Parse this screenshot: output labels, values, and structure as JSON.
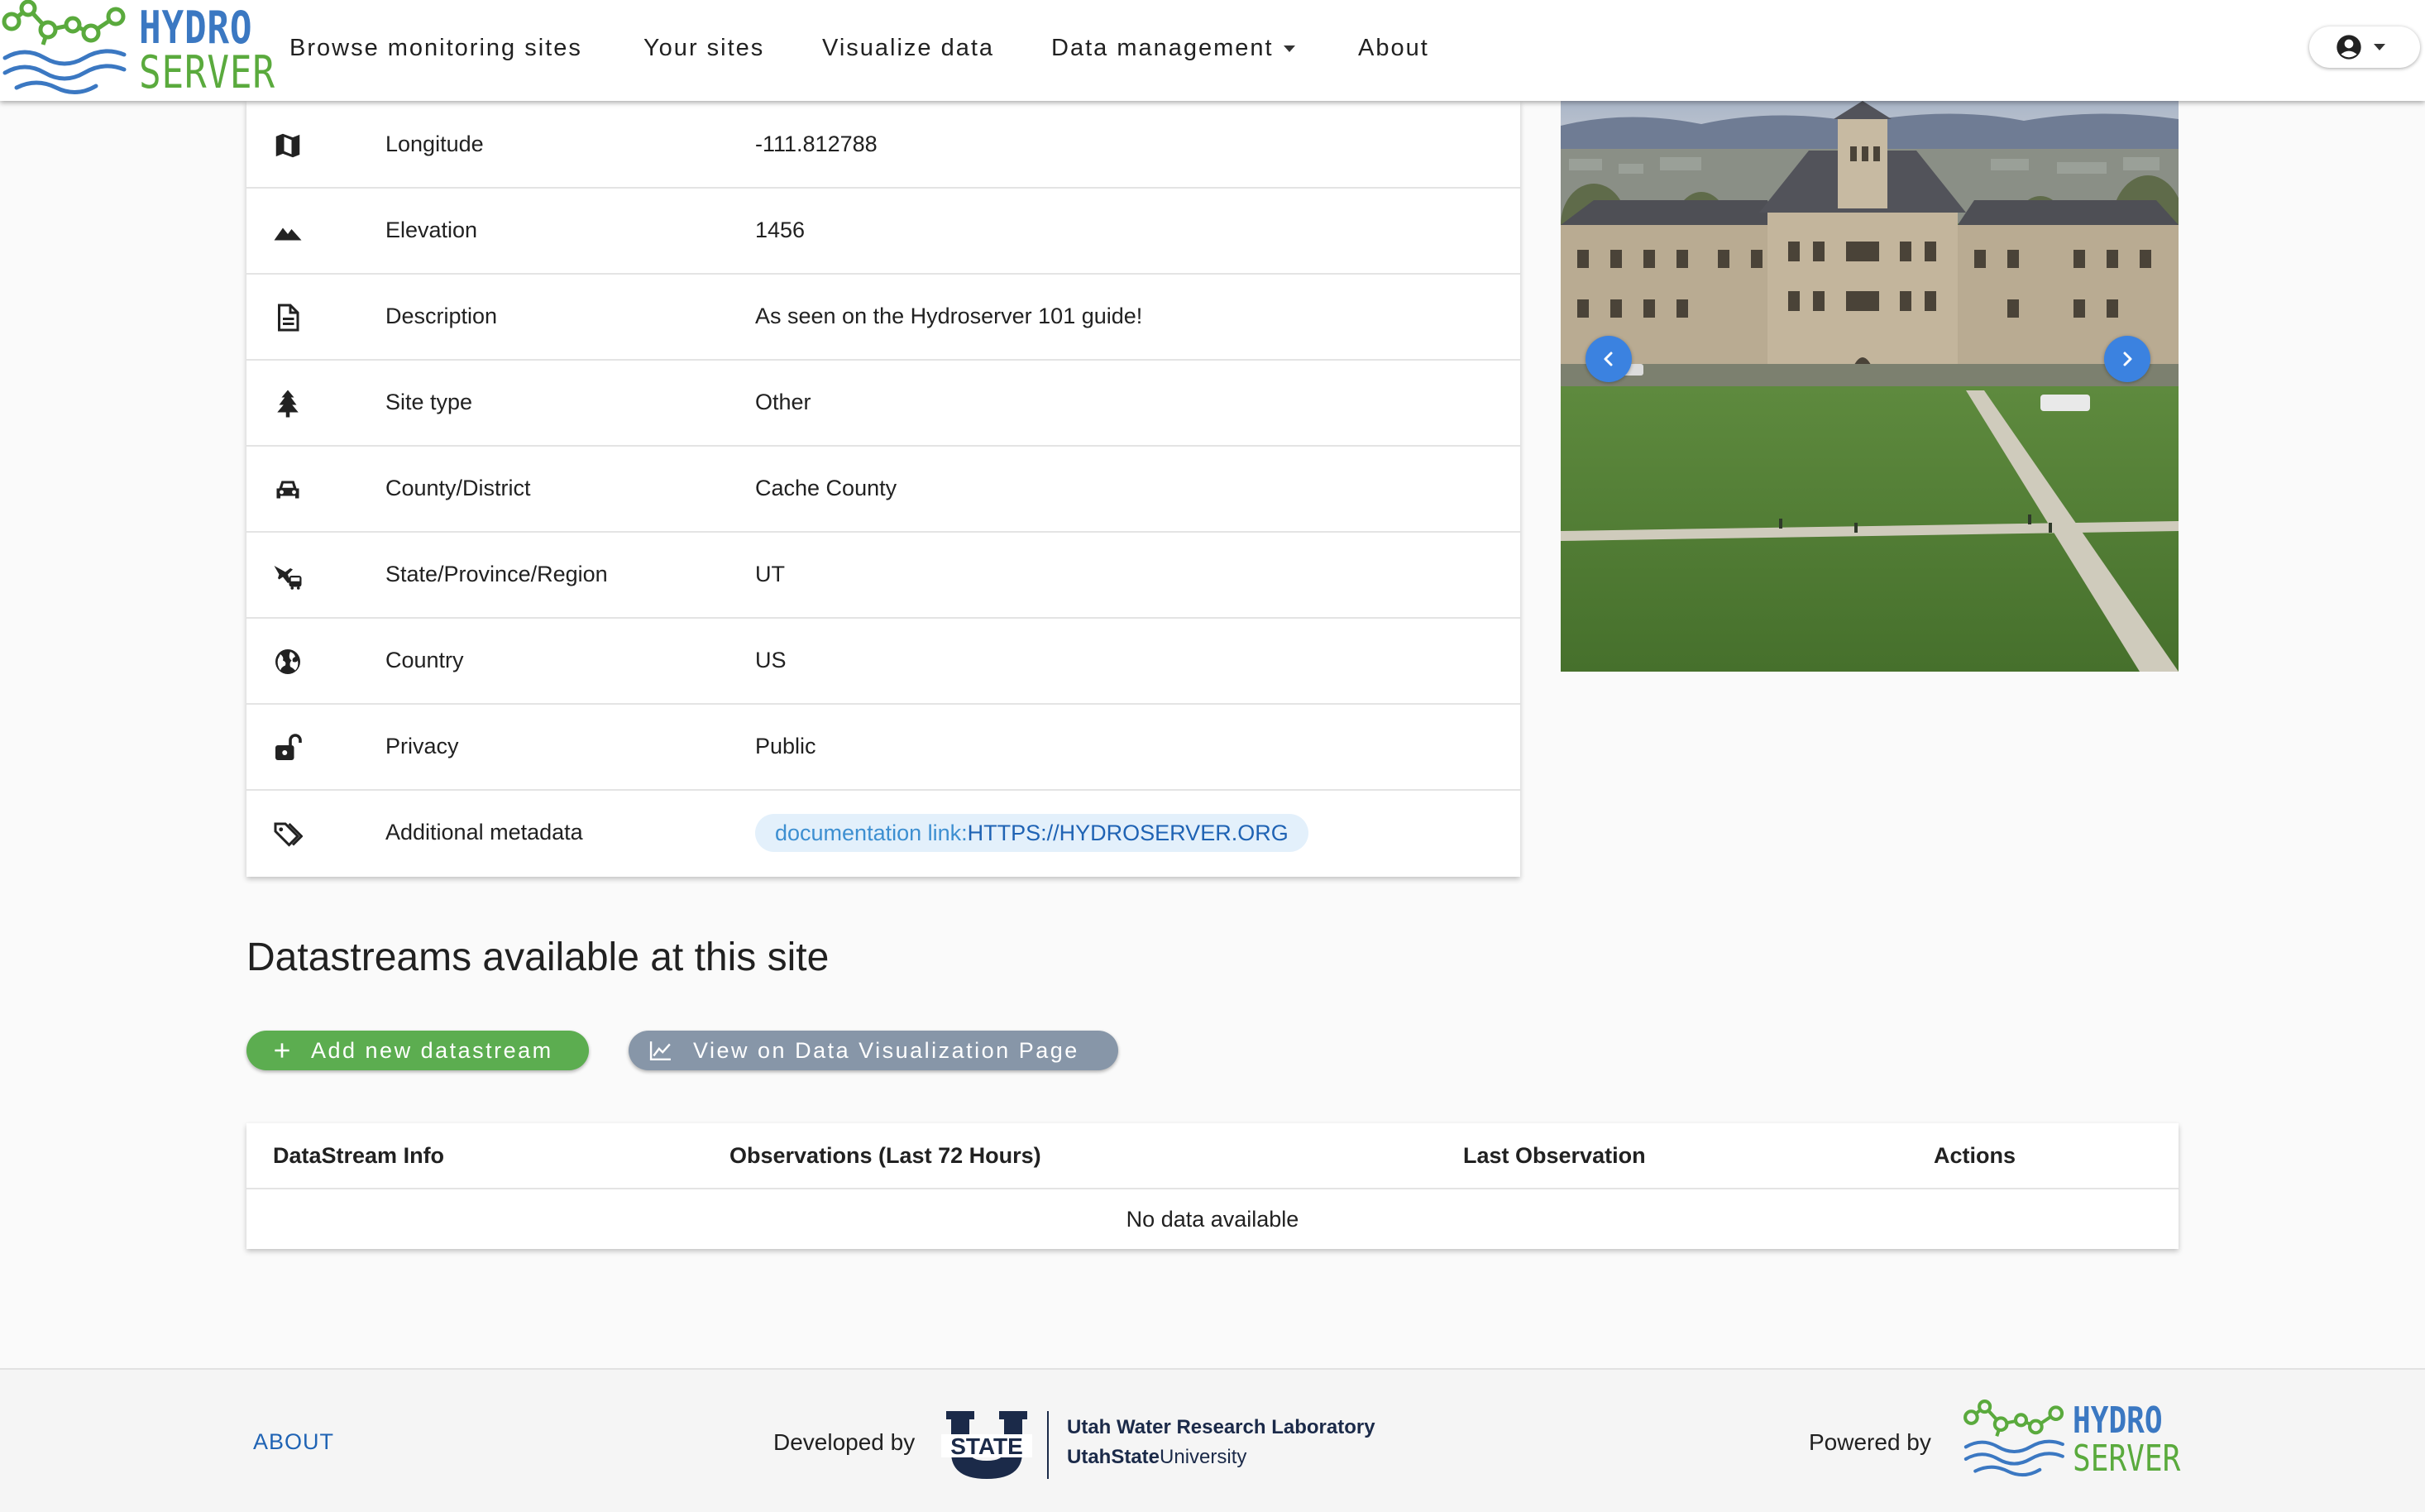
{
  "brand": {
    "line1": "HYDRO",
    "line2": "SERVER",
    "colors": {
      "blue": "#3b78c2",
      "green": "#5aaa3d"
    }
  },
  "nav": {
    "items": [
      {
        "label": "Browse monitoring sites"
      },
      {
        "label": "Your sites"
      },
      {
        "label": "Visualize data"
      },
      {
        "label": "Data management"
      },
      {
        "label": "About"
      }
    ],
    "account_icon": "account-circle-icon"
  },
  "site_info": {
    "rows": [
      {
        "icon": "map-icon",
        "label": "Longitude",
        "value": "-111.812788"
      },
      {
        "icon": "terrain-icon",
        "label": "Elevation",
        "value": "1456"
      },
      {
        "icon": "document-icon",
        "label": "Description",
        "value": "As seen on the Hydroserver 101 guide!"
      },
      {
        "icon": "pine-tree-icon",
        "label": "Site type",
        "value": "Other"
      },
      {
        "icon": "car-icon",
        "label": "County/District",
        "value": "Cache County"
      },
      {
        "icon": "transit-icon",
        "label": "State/Province/Region",
        "value": "UT"
      },
      {
        "icon": "globe-icon",
        "label": "Country",
        "value": "US"
      },
      {
        "icon": "lock-open-icon",
        "label": "Privacy",
        "value": "Public"
      },
      {
        "icon": "tags-icon",
        "label": "Additional metadata",
        "chip": {
          "key": "documentation link:",
          "value": "HTTPS://HYDROSERVER.ORG"
        }
      }
    ]
  },
  "carousel": {
    "prev_icon": "chevron-left-icon",
    "next_icon": "chevron-right-icon"
  },
  "datastreams": {
    "title": "Datastreams available at this site",
    "add_button": "Add new datastream",
    "viz_button": "View on Data Visualization Page",
    "columns": [
      "DataStream Info",
      "Observations (Last 72 Hours)",
      "Last Observation",
      "Actions"
    ],
    "empty_text": "No data available"
  },
  "footer": {
    "about": "ABOUT",
    "developed_by": "Developed by",
    "usu_mark": "STATE",
    "lab_name": "Utah Water Research Laboratory",
    "univ_bold": "UtahState",
    "univ_rest": "University",
    "powered_by": "Powered by"
  }
}
